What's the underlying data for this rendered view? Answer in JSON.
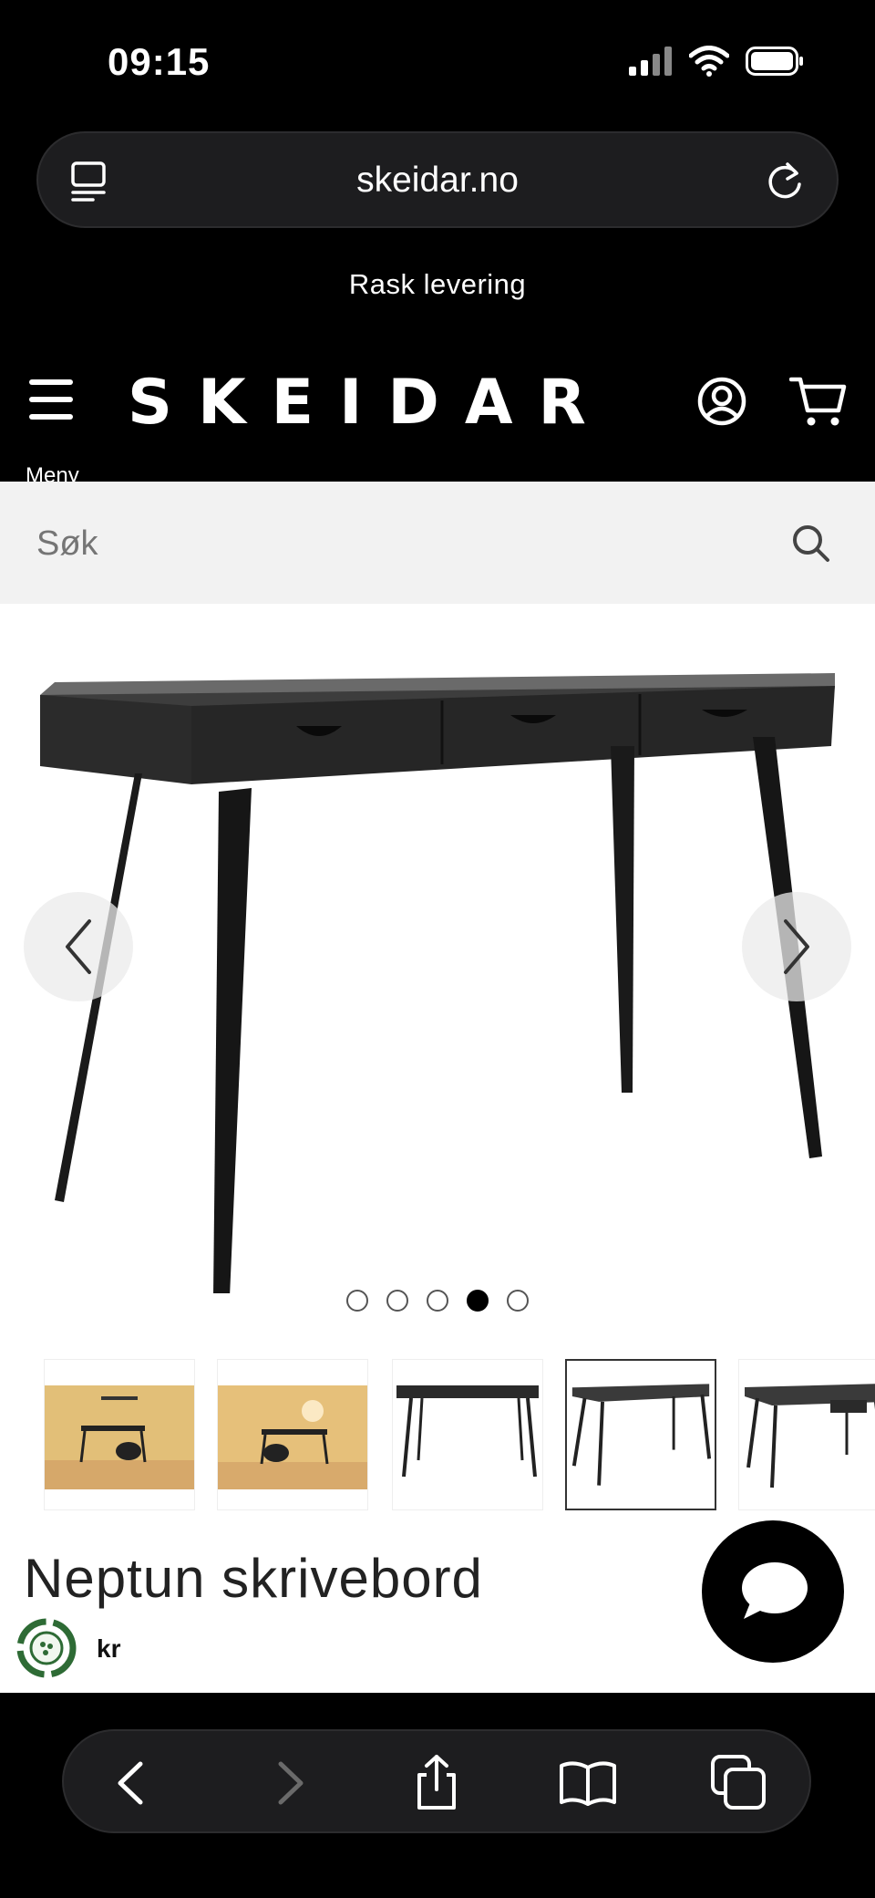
{
  "status_bar": {
    "time": "09:15"
  },
  "browser": {
    "url": "skeidar.no"
  },
  "promo": {
    "text": "Rask levering"
  },
  "header": {
    "logo": "SKEIDAR",
    "menu_label": "Meny"
  },
  "search": {
    "placeholder": "Søk"
  },
  "gallery": {
    "image_count": 5,
    "active_index": 3,
    "thumbnail_count": 5,
    "selected_thumbnail": 3
  },
  "product": {
    "title": "Neptun skrivebord",
    "price_prefix": "kr"
  },
  "colors": {
    "background": "#000000",
    "accent": "#000000",
    "search_bg": "#f2f2f2",
    "toolbar": "#1d1d1f"
  }
}
